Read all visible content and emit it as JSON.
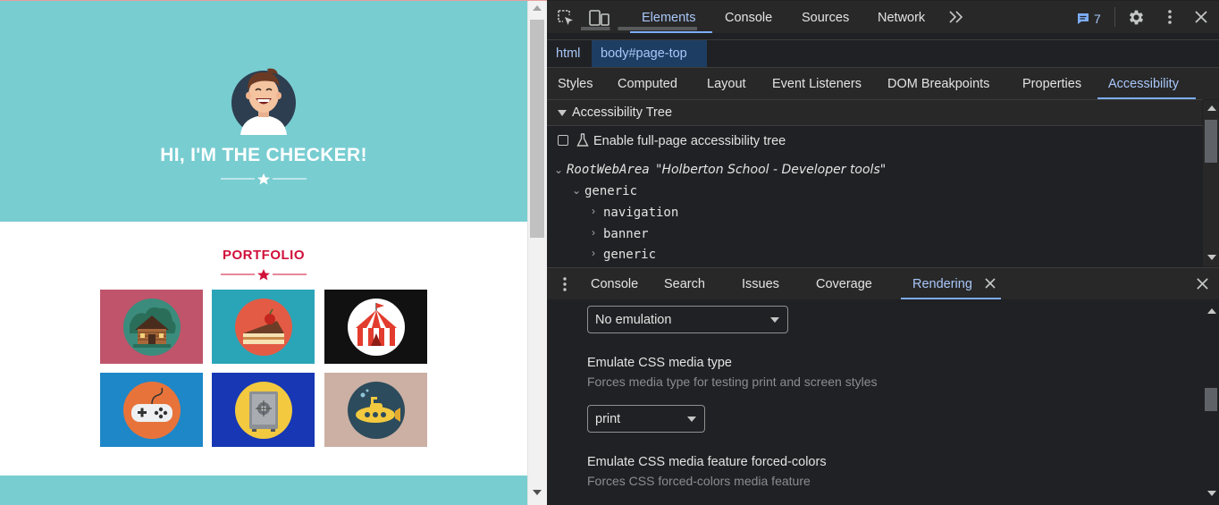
{
  "page": {
    "hero_title": "HI, I'M THE CHECKER!",
    "portfolio_title": "PORTFOLIO",
    "tiles": [
      {
        "name": "cabin",
        "bg": "#c0546b",
        "circle": "#3b8c7c"
      },
      {
        "name": "cake",
        "bg": "#2aa5b8",
        "circle": "#e35b44"
      },
      {
        "name": "circus-tent",
        "bg": "#111111",
        "circle": "#ffffff"
      },
      {
        "name": "gamepad",
        "bg": "#1e87c8",
        "circle": "#e8733a"
      },
      {
        "name": "safe",
        "bg": "#1737b5",
        "circle": "#f2c93f"
      },
      {
        "name": "submarine",
        "bg": "#cbb0a3",
        "circle": "#2c4b5c"
      }
    ],
    "colors": {
      "hero": "#78cdd1",
      "accent": "#d0103a"
    }
  },
  "devtools": {
    "main_tabs": [
      "Elements",
      "Console",
      "Sources",
      "Network"
    ],
    "issues_count": "7",
    "breadcrumb": {
      "html": "html",
      "body": "body#page-top"
    },
    "sub_tabs": [
      "Styles",
      "Computed",
      "Layout",
      "Event Listeners",
      "DOM Breakpoints",
      "Properties",
      "Accessibility"
    ],
    "acc_tree": {
      "header": "Accessibility Tree",
      "enable_label": "Enable full-page accessibility tree",
      "root_role": "RootWebArea",
      "root_name": "\"Holberton School - Developer tools\"",
      "items": [
        "generic",
        "navigation",
        "banner",
        "generic"
      ]
    },
    "drawer_tabs": [
      "Console",
      "Search",
      "Issues",
      "Coverage",
      "Rendering"
    ],
    "rendering": {
      "emulation_value": "No emulation",
      "media_type_title": "Emulate CSS media type",
      "media_type_desc": "Forces media type for testing print and screen styles",
      "media_type_value": "print",
      "forced_colors_title": "Emulate CSS media feature forced-colors",
      "forced_colors_desc": "Forces CSS forced-colors media feature"
    },
    "colors": {
      "accent_blue": "#7cacf8",
      "link_blue": "#a8c7fa"
    }
  }
}
